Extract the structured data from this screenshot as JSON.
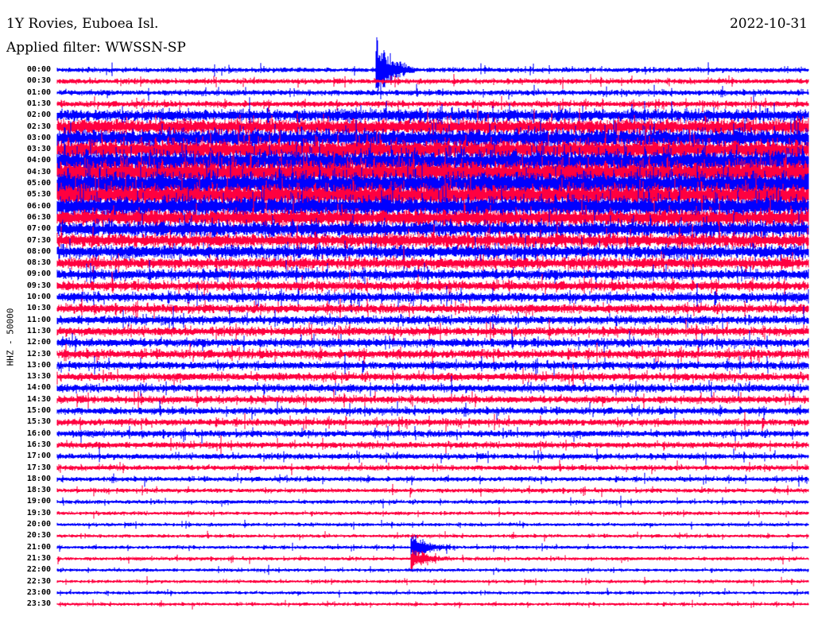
{
  "header": {
    "title": "1Y Rovies, Euboea Isl.",
    "filter": "Applied filter: WWSSN-SP",
    "date": "2022-10-31"
  },
  "chart_data": {
    "type": "line",
    "title": "1Y Rovies, Euboea Isl.",
    "ylabel": "HHZ - 50000",
    "row_labels": [
      "00:00",
      "00:30",
      "01:00",
      "01:30",
      "02:00",
      "02:30",
      "03:00",
      "03:30",
      "04:00",
      "04:30",
      "05:00",
      "05:30",
      "06:00",
      "06:30",
      "07:00",
      "07:30",
      "08:00",
      "08:30",
      "09:00",
      "09:30",
      "10:00",
      "10:30",
      "11:00",
      "11:30",
      "12:00",
      "12:30",
      "13:00",
      "13:30",
      "14:00",
      "14:30",
      "15:00",
      "15:30",
      "16:00",
      "16:30",
      "17:00",
      "17:30",
      "18:00",
      "18:30",
      "19:00",
      "19:30",
      "20:00",
      "20:30",
      "21:00",
      "21:30",
      "22:00",
      "22:30",
      "23:00",
      "23:30"
    ],
    "row_minutes": 30,
    "series_colors": [
      "#0000ff",
      "#ff0040"
    ],
    "relative_amplitude": [
      0.55,
      0.6,
      0.65,
      0.7,
      1.4,
      1.8,
      2.2,
      2.4,
      2.6,
      2.8,
      2.8,
      2.6,
      2.4,
      2.0,
      1.8,
      1.6,
      1.5,
      1.3,
      1.2,
      1.1,
      1.1,
      1.0,
      1.0,
      1.0,
      1.0,
      1.0,
      0.9,
      0.9,
      0.9,
      0.85,
      0.8,
      0.8,
      0.75,
      0.7,
      0.65,
      0.6,
      0.55,
      0.5,
      0.45,
      0.42,
      0.4,
      0.4,
      0.4,
      0.4,
      0.38,
      0.38,
      0.38,
      0.38
    ],
    "events": [
      {
        "row": 0,
        "minute": 12.8,
        "amplitude": 6
      },
      {
        "row": 42,
        "minute": 14.2,
        "amplitude": 2.5
      },
      {
        "row": 43,
        "minute": 14.2,
        "amplitude": 2
      }
    ]
  }
}
